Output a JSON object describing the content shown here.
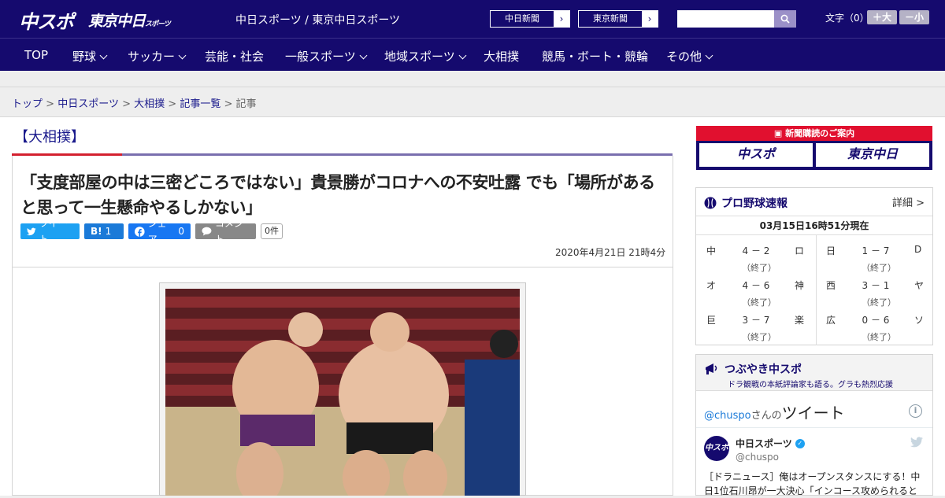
{
  "header": {
    "logo_chuspo": "中スポ",
    "logo_tokyo": "東京中日",
    "logo_tokyo_small": "スポーツ",
    "site_links": "中日スポーツ / 東京中日スポーツ",
    "ext_links": [
      {
        "label": "中日新聞",
        "arrow": "›"
      },
      {
        "label": "東京新聞",
        "arrow": "›"
      }
    ],
    "search_placeholder": "",
    "font_size_label": "文字（0）",
    "font_larger": "＋大",
    "font_smaller": "－小"
  },
  "nav": {
    "items": [
      {
        "label": "TOP",
        "has_menu": false
      },
      {
        "label": "野球",
        "has_menu": true
      },
      {
        "label": "サッカー",
        "has_menu": true
      },
      {
        "label": "芸能・社会",
        "has_menu": false
      },
      {
        "label": "一般スポーツ",
        "has_menu": true
      },
      {
        "label": "地域スポーツ",
        "has_menu": true
      },
      {
        "label": "大相撲",
        "has_menu": false
      },
      {
        "label": "競馬・ボート・競輪",
        "has_menu": false
      },
      {
        "label": "その他",
        "has_menu": true
      }
    ]
  },
  "breadcrumb": {
    "items": [
      "トップ",
      "中日スポーツ",
      "大相撲",
      "記事一覧"
    ],
    "current": "記事",
    "separator": ">"
  },
  "article": {
    "category": "【大相撲】",
    "title": "「支度部屋の中は三密どころではない」貴景勝がコロナへの不安吐露 でも「場所があると思って一生懸命やるしかない」",
    "share": {
      "tweet": "ツイート",
      "hatena_label": "B!",
      "hatena_count": "1",
      "fb_label": "シェア",
      "fb_count": "0",
      "comment_label": "コメント",
      "comment_count": "0件"
    },
    "date": "2020年4月21日 21時4分"
  },
  "sidebar": {
    "promo": {
      "heading": "新聞購読のご案内",
      "btn1": "中スポ",
      "btn2": "東京中日"
    },
    "baseball": {
      "title": "プロ野球速報",
      "more": "詳細 >",
      "as_of": "03月15日16時51分現在",
      "games": [
        {
          "home": "中",
          "score": "4 － 2",
          "away": "ロ",
          "status": "（終了）"
        },
        {
          "home": "日",
          "score": "1 － 7",
          "away": "D",
          "status": "（終了）"
        },
        {
          "home": "オ",
          "score": "4 － 6",
          "away": "神",
          "status": "（終了）"
        },
        {
          "home": "西",
          "score": "3 － 1",
          "away": "ヤ",
          "status": "（終了）"
        },
        {
          "home": "巨",
          "score": "3 － 7",
          "away": "楽",
          "status": "（終了）"
        },
        {
          "home": "広",
          "score": "0 － 6",
          "away": "ソ",
          "status": "（終了）"
        }
      ]
    },
    "tweets": {
      "title": "つぶやき中スポ",
      "subtitle": "ドラ観戦の本紙評論家も語る。グラも熱烈応援",
      "handle": "@chuspo",
      "handle_suffix": "さんの",
      "tweets_word": "ツイート",
      "info": "i",
      "account_name": "中日スポーツ",
      "account_user": "@chuspo",
      "avatar_text": "中スポ",
      "text": "［ドラニュース］俺はオープンスタンスにする！中日1位石川昂が一大決心「インコース攻められると"
    }
  },
  "colors": {
    "brand_navy": "#150a6e",
    "accent_red": "#d3202e",
    "twitter_blue": "#1da1f2"
  }
}
